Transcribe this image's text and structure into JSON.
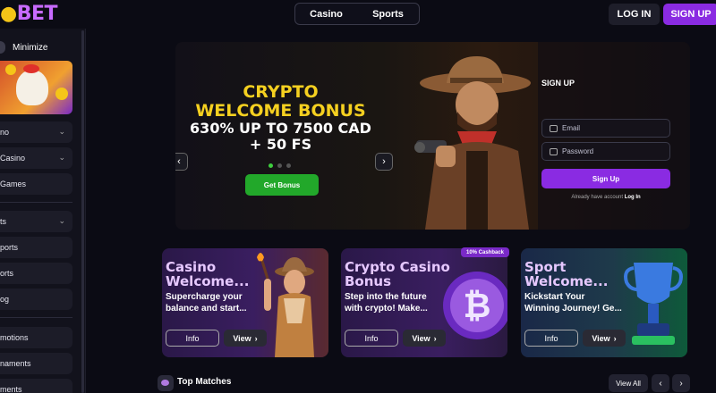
{
  "header": {
    "logo": "BET",
    "nav": [
      "Casino",
      "Sports"
    ],
    "login": "LOG IN",
    "signup": "SIGN UP"
  },
  "sidebar": {
    "minimize": "Minimize",
    "items": [
      {
        "label": "no",
        "chevron": true
      },
      {
        "label": "Casino",
        "chevron": true
      },
      {
        "label": "Games",
        "chevron": false
      },
      {
        "label": "ts",
        "chevron": true
      },
      {
        "label": "ports",
        "chevron": false
      },
      {
        "label": "orts",
        "chevron": false
      },
      {
        "label": "og",
        "chevron": false
      },
      {
        "label": "motions",
        "chevron": false
      },
      {
        "label": "naments",
        "chevron": false
      },
      {
        "label": "ments",
        "chevron": false
      }
    ]
  },
  "hero": {
    "title_line1": "CRYPTO",
    "title_line2": "WELCOME BONUS",
    "sub_line1": "630% UP TO 7500 CAD",
    "sub_line2": "+ 50 FS",
    "cta": "Get Bonus",
    "slides": 3,
    "active_slide": 0
  },
  "signup_panel": {
    "title": "SIGN UP",
    "email_placeholder": "Email",
    "password_placeholder": "Password",
    "button": "Sign Up",
    "footer_text": "Already have account",
    "footer_link": "Log In"
  },
  "cards": [
    {
      "title_l1": "Casino",
      "title_l2": "Welcome...",
      "desc_l1": "Supercharge your",
      "desc_l2": "balance and start...",
      "info": "Info",
      "view": "View"
    },
    {
      "title_l1": "Crypto Casino",
      "title_l2": "Bonus",
      "desc_l1": "Step into the future",
      "desc_l2": "with crypto! Make...",
      "info": "Info",
      "view": "View",
      "badge": "10% Cashback"
    },
    {
      "title_l1": "Sport",
      "title_l2": "Welcome...",
      "desc_l1": "Kickstart Your",
      "desc_l2": "Winning Journey! Ge...",
      "info": "Info",
      "view": "View"
    }
  ],
  "top_matches": {
    "title": "Top Matches",
    "view_all": "View All"
  }
}
